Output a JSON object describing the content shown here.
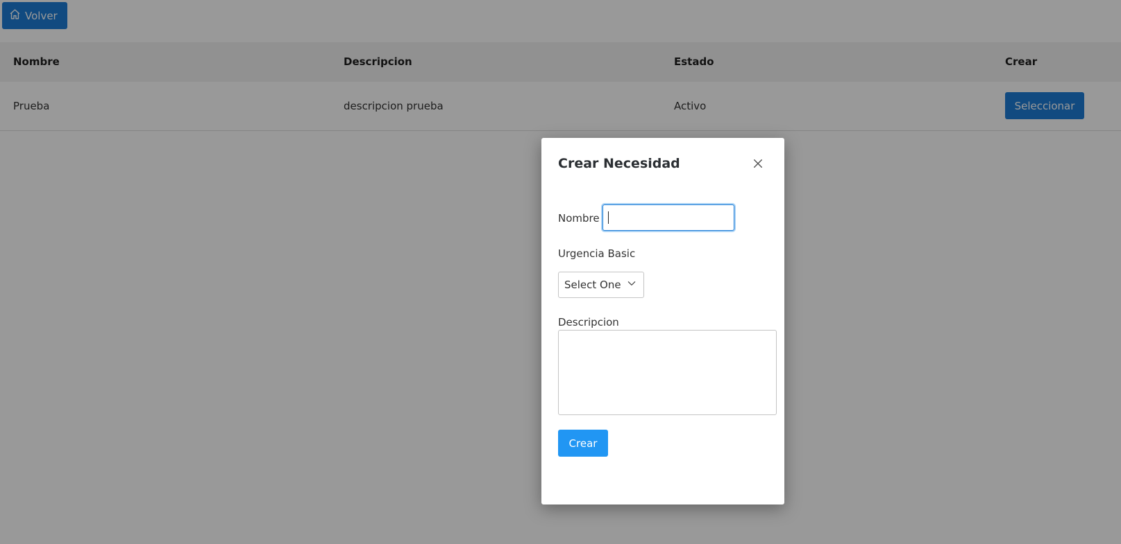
{
  "toolbar": {
    "back_label": "Volver",
    "back_icon": "home-icon"
  },
  "table": {
    "headers": [
      "Nombre",
      "Descripcion",
      "Estado",
      "Crear"
    ],
    "rows": [
      {
        "nombre": "Prueba",
        "descripcion": "descripcion prueba",
        "estado": "Activo",
        "action_label": "Seleccionar"
      }
    ]
  },
  "modal": {
    "title": "Crear Necesidad",
    "close_icon": "close-icon",
    "fields": {
      "nombre_label": "Nombre",
      "nombre_value": "",
      "urgencia_label": "Urgencia Basic",
      "urgencia_selected": "Select One",
      "descripcion_label": "Descripcion",
      "descripcion_value": ""
    },
    "submit_label": "Crear"
  },
  "colors": {
    "primary": "#1d7cd6",
    "submit": "#2196f3",
    "overlay": "rgba(0,0,0,0.4)"
  }
}
